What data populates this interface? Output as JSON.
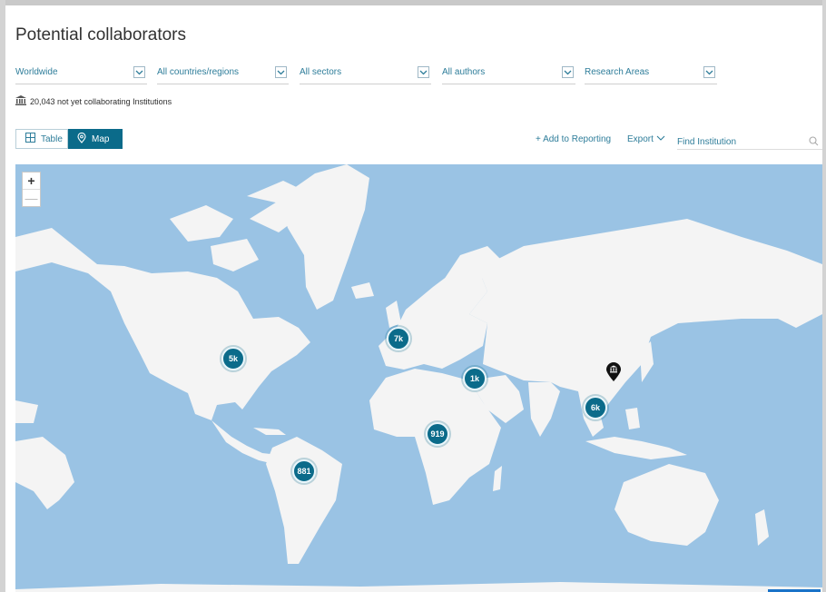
{
  "page": {
    "title": "Potential collaborators"
  },
  "filters": [
    {
      "label": "Worldwide"
    },
    {
      "label": "All countries/regions"
    },
    {
      "label": "All sectors"
    },
    {
      "label": "All authors"
    },
    {
      "label": "Research Areas"
    }
  ],
  "summary": {
    "text": "20,043 not yet collaborating Institutions",
    "icon": "institution-icon"
  },
  "view_toggle": {
    "table_label": "Table",
    "map_label": "Map",
    "active": "Map"
  },
  "toolbar": {
    "add_to_reporting": "+ Add to Reporting",
    "export": "Export",
    "find_placeholder": "Find Institution"
  },
  "map": {
    "zoom_in": "+",
    "zoom_out": "—",
    "clusters": [
      {
        "label": "5k"
      },
      {
        "label": "7k"
      },
      {
        "label": "1k"
      },
      {
        "label": "6k"
      },
      {
        "label": "919"
      },
      {
        "label": "881"
      }
    ],
    "colors": {
      "ocean": "#9ac3e4",
      "land": "#f4f4f4",
      "cluster": "#0b6b8a"
    }
  }
}
